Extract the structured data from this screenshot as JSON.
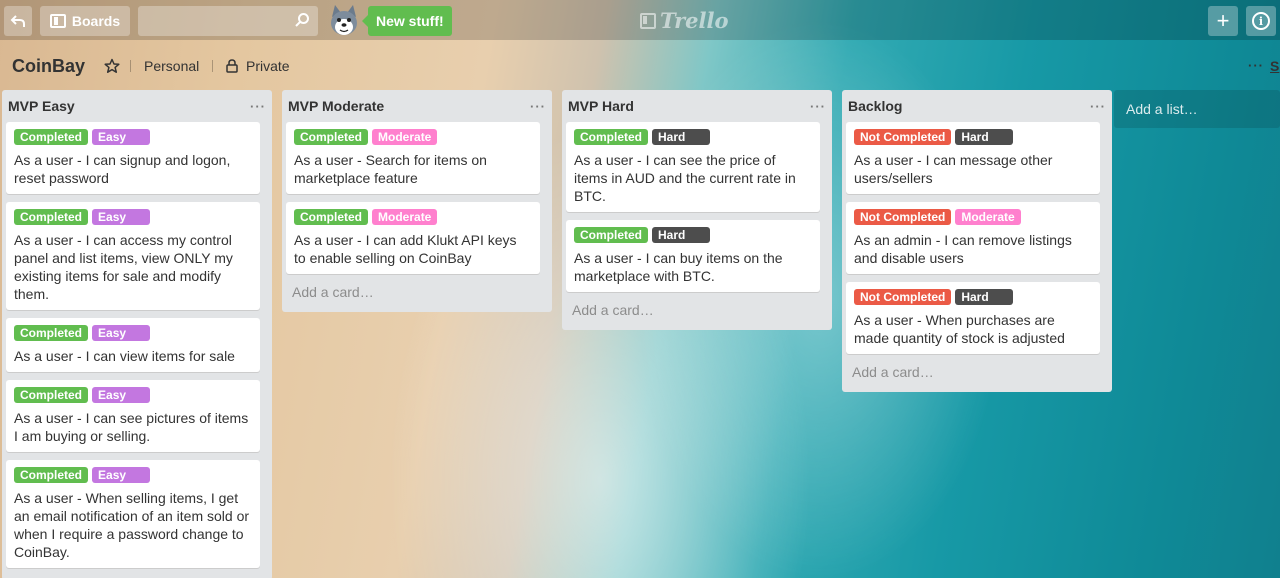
{
  "header": {
    "boards_label": "Boards",
    "new_stuff_label": "New stuff!",
    "logo_text": "Trello"
  },
  "board": {
    "title": "CoinBay",
    "team": "Personal",
    "visibility": "Private",
    "show_menu": "S"
  },
  "colors": {
    "completed": "#61bd4f",
    "not_completed": "#eb5a46",
    "easy": "#c377e0",
    "moderate": "#ff80ce",
    "hard": "#4d4d4d"
  },
  "lists": [
    {
      "title": "MVP Easy",
      "cards": [
        {
          "status": "Completed",
          "difficulty": "Easy",
          "text": "As a user - I can signup and logon, reset password"
        },
        {
          "status": "Completed",
          "difficulty": "Easy",
          "text": "As a user - I can access my control panel and list items, view ONLY my existing items for sale and modify them."
        },
        {
          "status": "Completed",
          "difficulty": "Easy",
          "text": "As a user - I can view items for sale"
        },
        {
          "status": "Completed",
          "difficulty": "Easy",
          "text": "As a user - I can see pictures of items I am buying or selling."
        },
        {
          "status": "Completed",
          "difficulty": "Easy",
          "text": "As a user - When selling items, I get an email notification of an item sold or when I require a password change to CoinBay."
        }
      ]
    },
    {
      "title": "MVP Moderate",
      "add_card": "Add a card…",
      "cards": [
        {
          "status": "Completed",
          "difficulty": "Moderate",
          "text": "As a user - Search for items on marketplace feature"
        },
        {
          "status": "Completed",
          "difficulty": "Moderate",
          "text": "As a user - I can add Klukt API keys to enable selling on CoinBay"
        }
      ]
    },
    {
      "title": "MVP Hard",
      "add_card": "Add a card…",
      "cards": [
        {
          "status": "Completed",
          "difficulty": "Hard",
          "text": "As a user - I can see the price of items in AUD and the current rate in BTC."
        },
        {
          "status": "Completed",
          "difficulty": "Hard",
          "text": "As a user - I can buy items on the marketplace with BTC."
        }
      ]
    },
    {
      "title": "Backlog",
      "add_card": "Add a card…",
      "cards": [
        {
          "status": "Not Completed",
          "difficulty": "Hard",
          "text": "As a user - I can message other users/sellers"
        },
        {
          "status": "Not Completed",
          "difficulty": "Moderate",
          "text": "As an admin - I can remove listings and disable users"
        },
        {
          "status": "Not Completed",
          "difficulty": "Hard",
          "text": "As a user - When purchases are made quantity of stock is adjusted"
        }
      ]
    }
  ],
  "add_list_label": "Add a list…"
}
